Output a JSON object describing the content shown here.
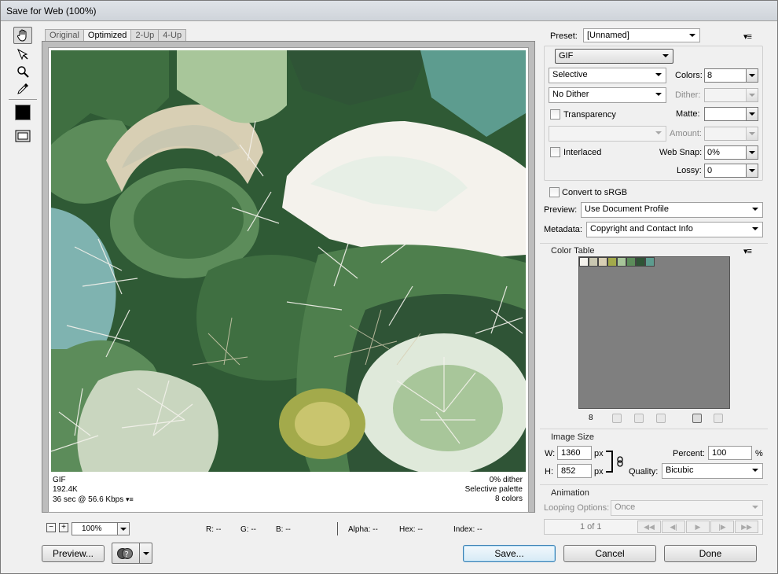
{
  "window": {
    "title": "Save for Web (100%)"
  },
  "tabs": [
    {
      "label": "Original"
    },
    {
      "label": "Optimized"
    },
    {
      "label": "2-Up"
    },
    {
      "label": "4-Up"
    }
  ],
  "image_info": {
    "format": "GIF",
    "size": "192.4K",
    "download_time": "36 sec @ 56.6 Kbps",
    "dither_pct": "0% dither",
    "palette": "Selective palette",
    "colors": "8 colors"
  },
  "status": {
    "zoom": "100%",
    "r": "R: --",
    "g": "G: --",
    "b": "B: --",
    "alpha": "Alpha: --",
    "hex": "Hex: --",
    "index": "Index: --"
  },
  "bottom_buttons": {
    "preview": "Preview...",
    "save": "Save...",
    "cancel": "Cancel",
    "done": "Done"
  },
  "settings": {
    "preset_label": "Preset:",
    "preset_value": "[Unnamed]",
    "format_value": "GIF",
    "reduction_value": "Selective",
    "colors_label": "Colors:",
    "colors_value": "8",
    "dither_algo_value": "No Dither",
    "dither_label": "Dither:",
    "transparency_label": "Transparency",
    "matte_label": "Matte:",
    "amount_label": "Amount:",
    "interlaced_label": "Interlaced",
    "websnap_label": "Web Snap:",
    "websnap_value": "0%",
    "lossy_label": "Lossy:",
    "lossy_value": "0",
    "convert_srgb_label": "Convert to sRGB",
    "preview_label": "Preview:",
    "preview_value": "Use Document Profile",
    "metadata_label": "Metadata:",
    "metadata_value": "Copyright and Contact Info"
  },
  "color_table": {
    "title": "Color Table",
    "count": "8",
    "swatches": [
      "#f4f2ec",
      "#c9c7b1",
      "#d8cfb4",
      "#a3aa4b",
      "#a8c69a",
      "#5c8c5a",
      "#2f5436",
      "#5d9c8f"
    ]
  },
  "image_size": {
    "title": "Image Size",
    "w_label": "W:",
    "w_value": "1360",
    "h_label": "H:",
    "h_value": "852",
    "unit": "px",
    "percent_label": "Percent:",
    "percent_value": "100",
    "percent_unit": "%",
    "quality_label": "Quality:",
    "quality_value": "Bicubic"
  },
  "animation": {
    "title": "Animation",
    "looping_label": "Looping Options:",
    "looping_value": "Once",
    "frame_counter": "1 of 1"
  }
}
